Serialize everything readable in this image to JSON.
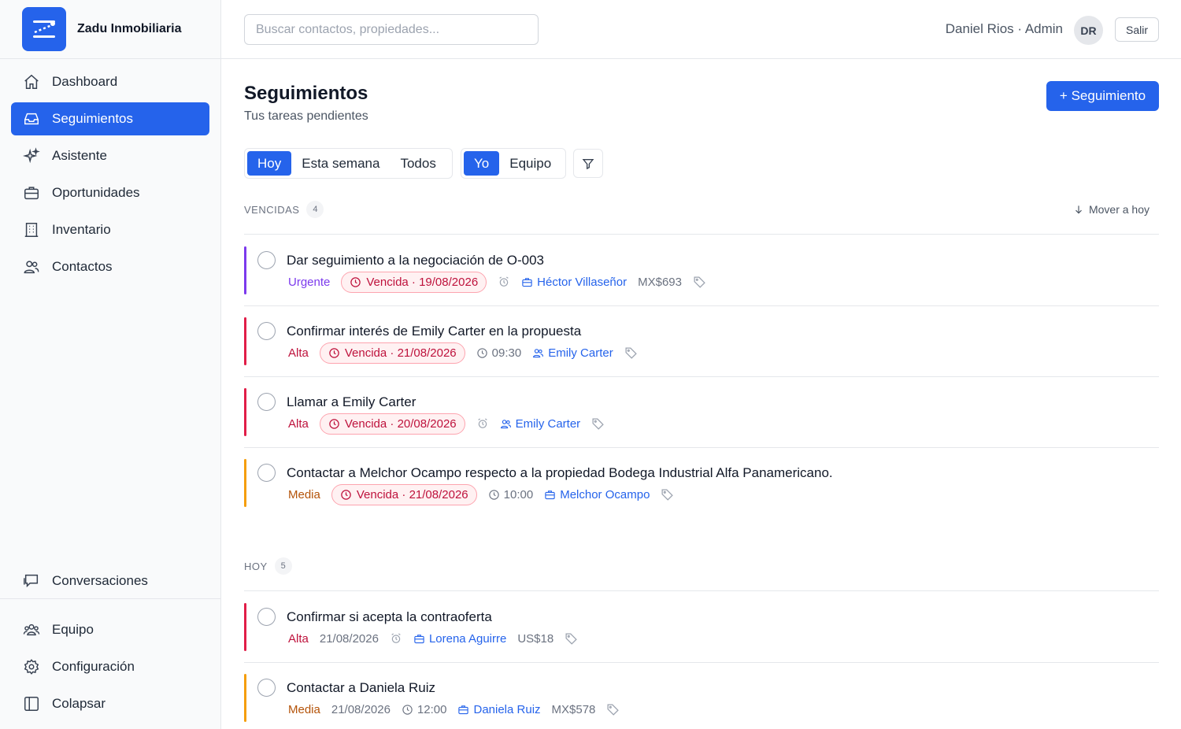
{
  "brand": {
    "name": "Zadu Inmobiliaria"
  },
  "sidebar": {
    "items": [
      {
        "label": "Dashboard",
        "icon": "home-icon",
        "active": false
      },
      {
        "label": "Seguimientos",
        "icon": "inbox-icon",
        "active": true
      },
      {
        "label": "Asistente",
        "icon": "sparkles-icon",
        "active": false
      },
      {
        "label": "Oportunidades",
        "icon": "briefcase-icon",
        "active": false
      },
      {
        "label": "Inventario",
        "icon": "building-icon",
        "active": false
      },
      {
        "label": "Contactos",
        "icon": "users-icon",
        "active": false
      }
    ],
    "conversations": {
      "label": "Conversaciones",
      "icon": "chat-icon"
    },
    "bottom": [
      {
        "label": "Equipo",
        "icon": "team-icon"
      },
      {
        "label": "Configuración",
        "icon": "gear-icon"
      },
      {
        "label": "Colapsar",
        "icon": "sidebar-collapse-icon"
      }
    ]
  },
  "topbar": {
    "search_placeholder": "Buscar contactos, propiedades...",
    "search_value": "",
    "user": "Daniel Rios · Admin",
    "avatar": "DR",
    "logout": "Salir"
  },
  "page": {
    "title": "Seguimientos",
    "subtitle": "Tus tareas pendientes",
    "new_button": "+ Seguimiento"
  },
  "filters": {
    "period": [
      {
        "label": "Hoy",
        "selected": true
      },
      {
        "label": "Esta semana",
        "selected": false
      },
      {
        "label": "Todos",
        "selected": false
      }
    ],
    "owner": [
      {
        "label": "Yo",
        "selected": true
      },
      {
        "label": "Equipo",
        "selected": false
      }
    ]
  },
  "sections": {
    "overdue": {
      "label": "VENCIDAS",
      "count": "4",
      "action": "Mover a hoy"
    },
    "today": {
      "label": "HOY",
      "count": "5"
    }
  },
  "colors": {
    "accent": "#2563eb",
    "urgent": "#7c3aed",
    "high": "#e11d48",
    "medium": "#f59e0b"
  },
  "tasks_overdue": [
    {
      "title": "Dar seguimiento a la negociación de O-003",
      "priority": "Urgente",
      "due": "Vencida · 19/08/2026",
      "time": "",
      "contact": "Héctor Villaseñor",
      "amount": "MX$693"
    },
    {
      "title": "Confirmar interés de Emily Carter en la propuesta",
      "priority": "Alta",
      "due": "Vencida · 21/08/2026",
      "time": "09:30",
      "contact": "Emily Carter",
      "amount": ""
    },
    {
      "title": "Llamar a Emily Carter",
      "priority": "Alta",
      "due": "Vencida · 20/08/2026",
      "time": "",
      "contact": "Emily Carter",
      "amount": ""
    },
    {
      "title": "Contactar a Melchor Ocampo respecto a la propiedad Bodega Industrial Alfa Panamericano.",
      "priority": "Media",
      "due": "Vencida · 21/08/2026",
      "time": "10:00",
      "contact": "Melchor Ocampo",
      "amount": ""
    }
  ],
  "tasks_today": [
    {
      "title": "Confirmar si acepta la contraoferta",
      "priority": "Alta",
      "date": "21/08/2026",
      "time": "",
      "contact": "Lorena Aguirre",
      "amount": "US$18"
    },
    {
      "title": "Contactar a Daniela Ruiz",
      "priority": "Media",
      "date": "21/08/2026",
      "time": "12:00",
      "contact": "Daniela Ruiz",
      "amount": "MX$578"
    }
  ]
}
